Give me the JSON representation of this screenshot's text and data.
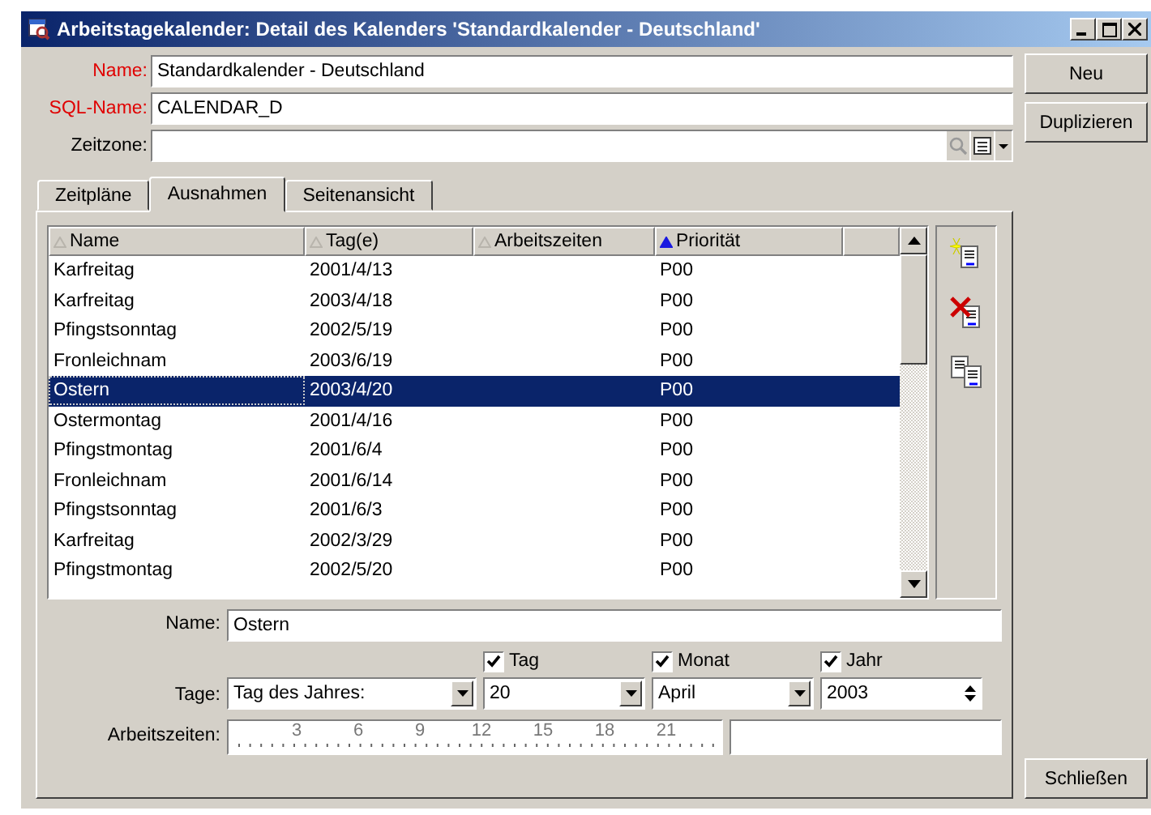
{
  "window": {
    "title": "Arbeitstagekalender: Detail des Kalenders 'Standardkalender - Deutschland'"
  },
  "fields": [
    {
      "label": "Name:",
      "value": "Standardkalender - Deutschland",
      "required": true,
      "kind": "text"
    },
    {
      "label": "SQL-Name:",
      "value": "CALENDAR_D",
      "required": true,
      "kind": "text"
    },
    {
      "label": "Zeitzone:",
      "required": false,
      "kind": "lookup"
    }
  ],
  "side_buttons": [
    "Neu",
    "Duplizieren"
  ],
  "tabs": [
    {
      "label": "Zeitpläne",
      "selected": false
    },
    {
      "label": "Ausnahmen",
      "selected": true
    },
    {
      "label": "Seitenansicht",
      "selected": false
    }
  ],
  "table": {
    "columns": [
      {
        "label": "Name",
        "sorted": false
      },
      {
        "label": "Tag(e)",
        "sorted": false
      },
      {
        "label": "Arbeitszeiten",
        "sorted": false
      },
      {
        "label": "Priorität",
        "sorted": true
      }
    ],
    "rows": [
      {
        "name": "Karfreitag",
        "days": "2001/4/13",
        "hours": "",
        "priority": "P00",
        "selected": false
      },
      {
        "name": "Karfreitag",
        "days": "2003/4/18",
        "hours": "",
        "priority": "P00",
        "selected": false
      },
      {
        "name": "Pfingstsonntag",
        "days": "2002/5/19",
        "hours": "",
        "priority": "P00",
        "selected": false
      },
      {
        "name": "Fronleichnam",
        "days": "2003/6/19",
        "hours": "",
        "priority": "P00",
        "selected": false
      },
      {
        "name": "Ostern",
        "days": "2003/4/20",
        "hours": "",
        "priority": "P00",
        "selected": true
      },
      {
        "name": "Ostermontag",
        "days": "2001/4/16",
        "hours": "",
        "priority": "P00",
        "selected": false
      },
      {
        "name": "Pfingstmontag",
        "days": "2001/6/4",
        "hours": "",
        "priority": "P00",
        "selected": false
      },
      {
        "name": "Fronleichnam",
        "days": "2001/6/14",
        "hours": "",
        "priority": "P00",
        "selected": false
      },
      {
        "name": "Pfingstsonntag",
        "days": "2001/6/3",
        "hours": "",
        "priority": "P00",
        "selected": false
      },
      {
        "name": "Karfreitag",
        "days": "2002/3/29",
        "hours": "",
        "priority": "P00",
        "selected": false
      },
      {
        "name": "Pfingstmontag",
        "days": "2002/5/20",
        "hours": "",
        "priority": "P00",
        "selected": false
      }
    ]
  },
  "detail": {
    "name_label": "Name:",
    "name_value": "Ostern",
    "days_label": "Tage:",
    "days_mode": "Tag des Jahres:",
    "parts": [
      {
        "label": "Tag",
        "checked": true,
        "value": "20",
        "kind": "dropdown"
      },
      {
        "label": "Monat",
        "checked": true,
        "value": "April",
        "kind": "dropdown"
      },
      {
        "label": "Jahr",
        "checked": true,
        "value": "2003",
        "kind": "spinner"
      }
    ],
    "hours_label": "Arbeitszeiten:",
    "ruler_ticks": [
      "3",
      "6",
      "9",
      "12",
      "15",
      "18",
      "21"
    ]
  },
  "close_button": "Schließen"
}
